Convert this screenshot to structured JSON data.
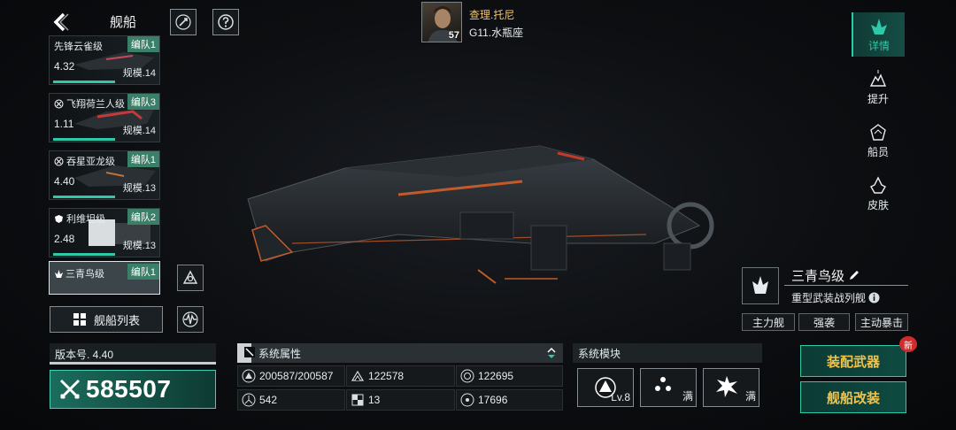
{
  "header": {
    "title": "舰船",
    "commander": {
      "name": "查理.托尼",
      "level": "57",
      "rank": "G11.水瓶座"
    }
  },
  "ship_list": [
    {
      "name": "先锋云雀级",
      "fleet": "编队1",
      "version": "4.32",
      "scale": "规模.14"
    },
    {
      "name": "飞翔荷兰人级",
      "fleet": "编队3",
      "version": "1.11",
      "scale": "规模.14"
    },
    {
      "name": "吞星亚龙级",
      "fleet": "编队1",
      "version": "4.40",
      "scale": "规模.13"
    },
    {
      "name": "利维坦级",
      "fleet": "编队2",
      "version": "2.48",
      "scale": "规模.13"
    },
    {
      "name": "三青鸟级",
      "fleet": "编队1"
    }
  ],
  "list_button": "舰船列表",
  "version_label": "版本号. 4.40",
  "power": "585507",
  "attributes": {
    "title": "系统属性",
    "values": [
      "200587/200587",
      "122578",
      "122695",
      "542",
      "13",
      "17696"
    ]
  },
  "modules": {
    "title": "系统模块",
    "items": [
      {
        "icon": "core-module-icon",
        "label": "Lv.8"
      },
      {
        "icon": "cannon-module-icon",
        "label": "满"
      },
      {
        "icon": "burst-module-icon",
        "label": "满"
      }
    ]
  },
  "nav": [
    {
      "label": "详情",
      "icon": "detail-icon",
      "active": true
    },
    {
      "label": "提升",
      "icon": "upgrade-icon"
    },
    {
      "label": "船员",
      "icon": "crew-icon"
    },
    {
      "label": "皮肤",
      "icon": "skin-icon"
    }
  ],
  "ship": {
    "name": "三青鸟级",
    "type": "重型武装战列舰",
    "tags": [
      "主力舰",
      "强袭",
      "主动暴击"
    ]
  },
  "actions": {
    "equip": "装配武器",
    "modify": "舰船改装",
    "new_badge": "新"
  },
  "colors": {
    "accent": "#2ec9a8",
    "gold": "#f1c34a",
    "commander": "#f2c66d"
  }
}
